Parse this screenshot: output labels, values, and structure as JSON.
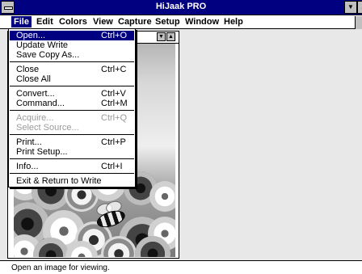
{
  "app": {
    "title": "HiJaak PRO"
  },
  "menubar": [
    {
      "label": "File",
      "active": true
    },
    {
      "label": "Edit"
    },
    {
      "label": "Colors"
    },
    {
      "label": "View"
    },
    {
      "label": "Capture"
    },
    {
      "label": "Setup"
    },
    {
      "label": "Window"
    },
    {
      "label": "Help"
    }
  ],
  "file_menu": [
    {
      "label": "Open...",
      "shortcut": "Ctrl+O",
      "highlight": true
    },
    {
      "label": "Update Write"
    },
    {
      "label": "Save Copy As..."
    },
    {
      "type": "separator"
    },
    {
      "label": "Close",
      "shortcut": "Ctrl+C"
    },
    {
      "label": "Close All"
    },
    {
      "type": "separator"
    },
    {
      "label": "Convert...",
      "shortcut": "Ctrl+V"
    },
    {
      "label": "Command...",
      "shortcut": "Ctrl+M"
    },
    {
      "type": "separator"
    },
    {
      "label": "Acquire...",
      "shortcut": "Ctrl+Q",
      "disabled": true
    },
    {
      "label": "Select Source...",
      "disabled": true
    },
    {
      "type": "separator"
    },
    {
      "label": "Print...",
      "shortcut": "Ctrl+P"
    },
    {
      "label": "Print Setup..."
    },
    {
      "type": "separator"
    },
    {
      "label": "Info...",
      "shortcut": "Ctrl+I"
    },
    {
      "type": "separator"
    },
    {
      "label": "Exit & Return to Write"
    }
  ],
  "status_bar": {
    "text": "Open an image for viewing."
  },
  "icons": {
    "system_menu": "system-menu-icon",
    "scroll_down": "scroll-down-icon",
    "scroll_up": "scroll-up-icon"
  },
  "colors": {
    "titlebar": "#000080",
    "menu_highlight": "#000080"
  }
}
